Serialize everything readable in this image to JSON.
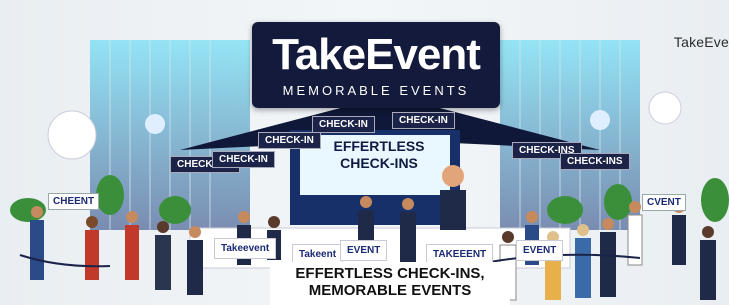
{
  "brand": {
    "corner": "TakeEve",
    "logo": "TakeEvent",
    "tagline": "MEMORABLE EVENTS"
  },
  "canopy": [
    "CHECK-INS",
    "CHECK-IN",
    "CHECK-IN",
    "CHECK-IN",
    "CHECK-IN",
    "CHECK-INS",
    "CHECK-INS"
  ],
  "screen": {
    "line1": "EFFERTLESS",
    "line2": "CHECK-INS"
  },
  "counters": [
    "Takeevent",
    "Takeent",
    "EVENT",
    "TAKEEENT",
    "EVENT"
  ],
  "sides": {
    "left": "CHEENT",
    "right": "CVENT"
  },
  "banner": {
    "line1": "EFFERTLESS CHECK-INS,",
    "line2": "MEMORABLE EVENTS"
  }
}
